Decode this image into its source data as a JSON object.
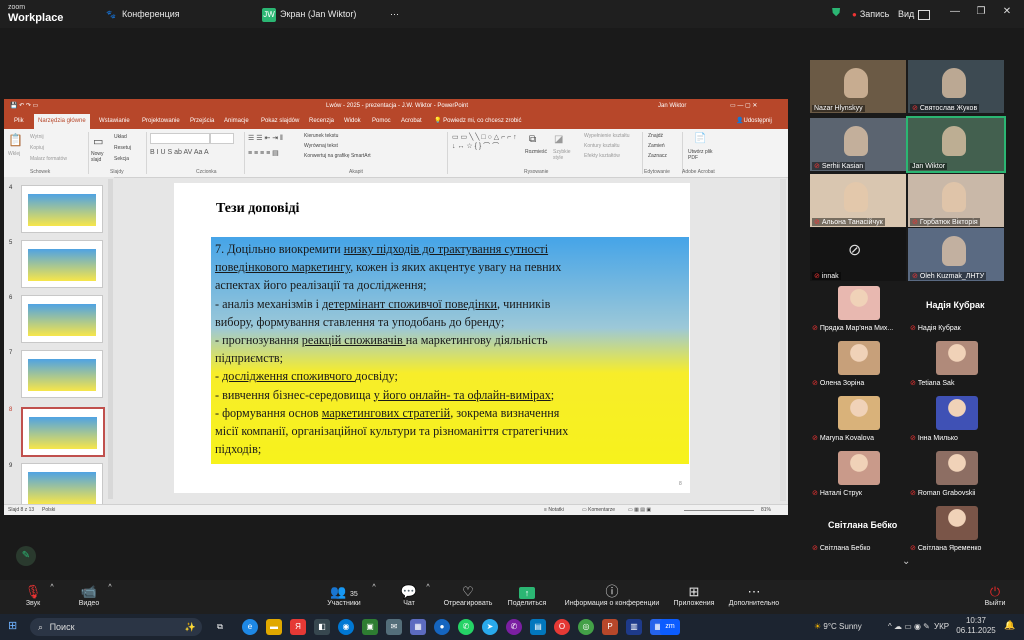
{
  "app": {
    "logo_top": "zoom",
    "logo_bottom": "Workplace"
  },
  "tabs": [
    {
      "label": "Конференция"
    },
    {
      "label": "Экран (Jan Wiktor)"
    }
  ],
  "topbar_right": {
    "record": "Запись",
    "view": "Вид"
  },
  "ppt": {
    "title": "Lwów - 2025 - prezentacja - J.W. Wiktor - PowerPoint",
    "user": "Jan Wiktor",
    "menu": [
      "Plik",
      "Narzędzia główne",
      "Wstawianie",
      "Projektowanie",
      "Przejścia",
      "Animacje",
      "Pokaz slajdów",
      "Recenzja",
      "Widok",
      "Pomoc",
      "Acrobat",
      "Powiedz mi, co chcesz zrobić"
    ],
    "share": "Udostępnij",
    "ribbon": {
      "wklej": "Wklej",
      "wytnij": "Wytnij",
      "kopiuj": "Kopiuj",
      "malarz": "Malarz formatów",
      "schowek": "Schowek",
      "nowy": "Nowy slajd",
      "uklad": "Układ",
      "resetuj": "Resetuj",
      "sekcja": "Sekcja",
      "slajdy": "Slajdy",
      "czcionka": "Czcionka",
      "kierunek": "Kierunek tekstu",
      "wyrownaj": "Wyrównaj tekst",
      "smartart": "Konwertuj na grafikę SmartArt",
      "akapit": "Akapit",
      "rozmiesc": "Rozmieść",
      "style": "Szybkie style",
      "wypelnienie": "Wypełnienie kształtu",
      "kontury": "Kontury kształtu",
      "efekty": "Efekty kształtów",
      "rysowanie": "Rysowanie",
      "znajdz": "Znajdź",
      "zamien": "Zamień",
      "zaznacz": "Zaznacz",
      "edytowanie": "Edytowanie",
      "pdf": "Utwórz plik PDF",
      "acrobat": "Adobe Acrobat"
    },
    "thumbs": [
      "4",
      "5",
      "6",
      "7",
      "8",
      "9"
    ],
    "status": {
      "slide": "Slajd 8 z 13",
      "lang": "Polski",
      "notes": "Notatki",
      "comments": "Komentarze",
      "zoom": "81%"
    }
  },
  "slide": {
    "heading": "Тези доповіді",
    "page": "8",
    "lines": [
      {
        "segments": [
          {
            "t": "7. Доцільно виокремити "
          },
          {
            "t": "низку підходів до трактування сутності",
            "u": true
          }
        ]
      },
      {
        "segments": [
          {
            "t": "поведінкового маркетингу",
            "u": true
          },
          {
            "t": ", кожен із яких акцентує увагу на певних"
          }
        ]
      },
      {
        "segments": [
          {
            "t": "аспектах його реалізації та дослідження;"
          }
        ]
      },
      {
        "segments": [
          {
            "t": "- аналіз механізмів і "
          },
          {
            "t": "детермінант споживчої поведінки",
            "u": true
          },
          {
            "t": ", чинників"
          }
        ]
      },
      {
        "segments": [
          {
            "t": "вибору, формування ставлення та уподобань до бренду;"
          }
        ]
      },
      {
        "segments": [
          {
            "t": "- прогнозування "
          },
          {
            "t": "реакцій споживачів ",
            "u": true
          },
          {
            "t": "на маркетингову діяльність"
          }
        ]
      },
      {
        "segments": [
          {
            "t": "підприємств;"
          }
        ]
      },
      {
        "segments": [
          {
            "t": "- "
          },
          {
            "t": "дослідження споживчого ",
            "u": true
          },
          {
            "t": "досвіду;"
          }
        ]
      },
      {
        "segments": [
          {
            "t": "- вивчення бізнес-середовища "
          },
          {
            "t": "у його онлайн- та офлайн-вимірах",
            "u": true
          },
          {
            "t": ";"
          }
        ]
      },
      {
        "segments": [
          {
            "t": "- формування основ "
          },
          {
            "t": "маркетингових стратегій",
            "u": true
          },
          {
            "t": ", зокрема визначення"
          }
        ]
      },
      {
        "segments": [
          {
            "t": "місії компанії, організаційної культури та різноманіття стратегічних"
          }
        ]
      },
      {
        "segments": [
          {
            "t": "підходів;"
          }
        ]
      }
    ]
  },
  "participants": [
    {
      "name": "Nazar Hlynskyy",
      "muted": false
    },
    {
      "name": "Святослав Жуков",
      "muted": true
    },
    {
      "name": "Serhii Kasian",
      "muted": true
    },
    {
      "name": "Jan Wiktor",
      "muted": false
    },
    {
      "name": "Альона Танасійчук",
      "muted": true
    },
    {
      "name": "Горбатюк Вікторія",
      "muted": true
    },
    {
      "name": "innak",
      "muted": true
    },
    {
      "name": "Oleh Kuzmak_ЛНТУ",
      "muted": true
    },
    {
      "name": "Прядка Мар'яна Мих...",
      "muted": true
    },
    {
      "name": "Надія Кубрак",
      "muted": true,
      "big": "Надія Кубрак"
    },
    {
      "name": "Олена Зоріна",
      "muted": true
    },
    {
      "name": "Tetiana Sak",
      "muted": true
    },
    {
      "name": "Maryna Kovalova",
      "muted": true
    },
    {
      "name": "Інна Милько",
      "muted": true
    },
    {
      "name": "Наталі Струк",
      "muted": true
    },
    {
      "name": "Roman Grabovskii",
      "muted": true
    },
    {
      "name": "Світлана Бебко",
      "muted": true,
      "big": "Світлана Бебко"
    },
    {
      "name": "Світлана Яременко",
      "muted": true
    }
  ],
  "toolbar": {
    "sound": "Звук",
    "video": "Видео",
    "participants": "Участники",
    "participants_count": "35",
    "chat": "Чат",
    "react": "Отреагировать",
    "share": "Поделиться",
    "info": "Информация о конференции",
    "apps": "Приложения",
    "more": "Дополнительно",
    "leave": "Выйти"
  },
  "taskbar": {
    "search": "Поиск",
    "weather": "9°C  Sunny",
    "lang": "УКР",
    "time": "10:37",
    "date": "06.11.2025"
  },
  "colors": {
    "ppt_red": "#b7472a",
    "zoom_share": "#2bb673",
    "leave": "#e02828"
  }
}
